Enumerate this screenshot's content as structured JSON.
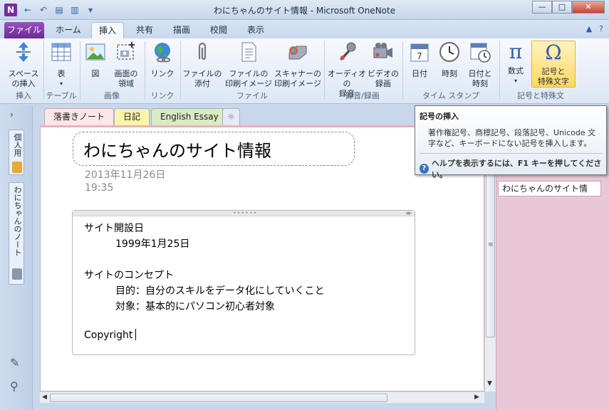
{
  "window": {
    "title": "わにちゃんのサイト情報 - Microsoft OneNote",
    "app_icon": "N",
    "controls": {
      "minimize": "—",
      "maximize": "□",
      "close": "✕"
    }
  },
  "qat": {
    "back": "←",
    "undo": "↶",
    "view": "▤",
    "dock": "▥",
    "more": "▾"
  },
  "ribbon_tabs": {
    "file": "ファイル",
    "tabs": [
      "ホーム",
      "挿入",
      "共有",
      "描画",
      "校閲",
      "表示"
    ],
    "active": "挿入",
    "right_icons": [
      "▲",
      "?"
    ]
  },
  "ribbon": {
    "buttons": {
      "space": "スペース\nの挿入",
      "table": "表",
      "picture": "図",
      "screen_clip": "画面の\n領域",
      "link": "リンク",
      "attach": "ファイルの\n添付",
      "file_printout": "ファイルの\n印刷イメージ",
      "scanner": "スキャナーの\n印刷イメージ",
      "audio": "オーディオの\n録音",
      "video": "ビデオの\n録画",
      "date": "日付",
      "time": "時刻",
      "date_time": "日付と\n時刻",
      "equation": "数式",
      "symbol": "記号と\n特殊文字"
    },
    "groups": [
      "挿入",
      "テーブル",
      "画像",
      "リンク",
      "ファイル",
      "録音/録画",
      "タイム スタンプ",
      "記号と特殊文"
    ]
  },
  "tooltip": {
    "title": "記号の挿入",
    "body": "著作権記号、商標記号、段落記号、Unicode 文字など、キーボードにない記号を挿入します。",
    "help": "ヘルプを表示するには、F1 キーを押してください。"
  },
  "nav": {
    "expand": "›",
    "notebooks": [
      "個人用",
      "わにちゃんのノート"
    ]
  },
  "section_tabs": {
    "tabs": [
      "落書きノート",
      "日記",
      "English Essay"
    ],
    "add": "☼"
  },
  "page": {
    "title": "わにちゃんのサイト情報",
    "date": "2013年11月26日",
    "time": "19:35",
    "lines": [
      {
        "text": "サイト開設日",
        "indent": 0
      },
      {
        "text": "1999年1月25日",
        "indent": 1
      },
      {
        "text": "サイトのコンセプト",
        "indent": 0
      },
      {
        "text": "目的：自分のスキルをデータ化にしていくこと",
        "indent": 1
      },
      {
        "text": "対象：基本的にパソコン初心者対象",
        "indent": 1
      },
      {
        "text": "Copyright",
        "indent": 0
      }
    ]
  },
  "page_list": {
    "items": [
      "わにちゃんのサイト情"
    ]
  }
}
